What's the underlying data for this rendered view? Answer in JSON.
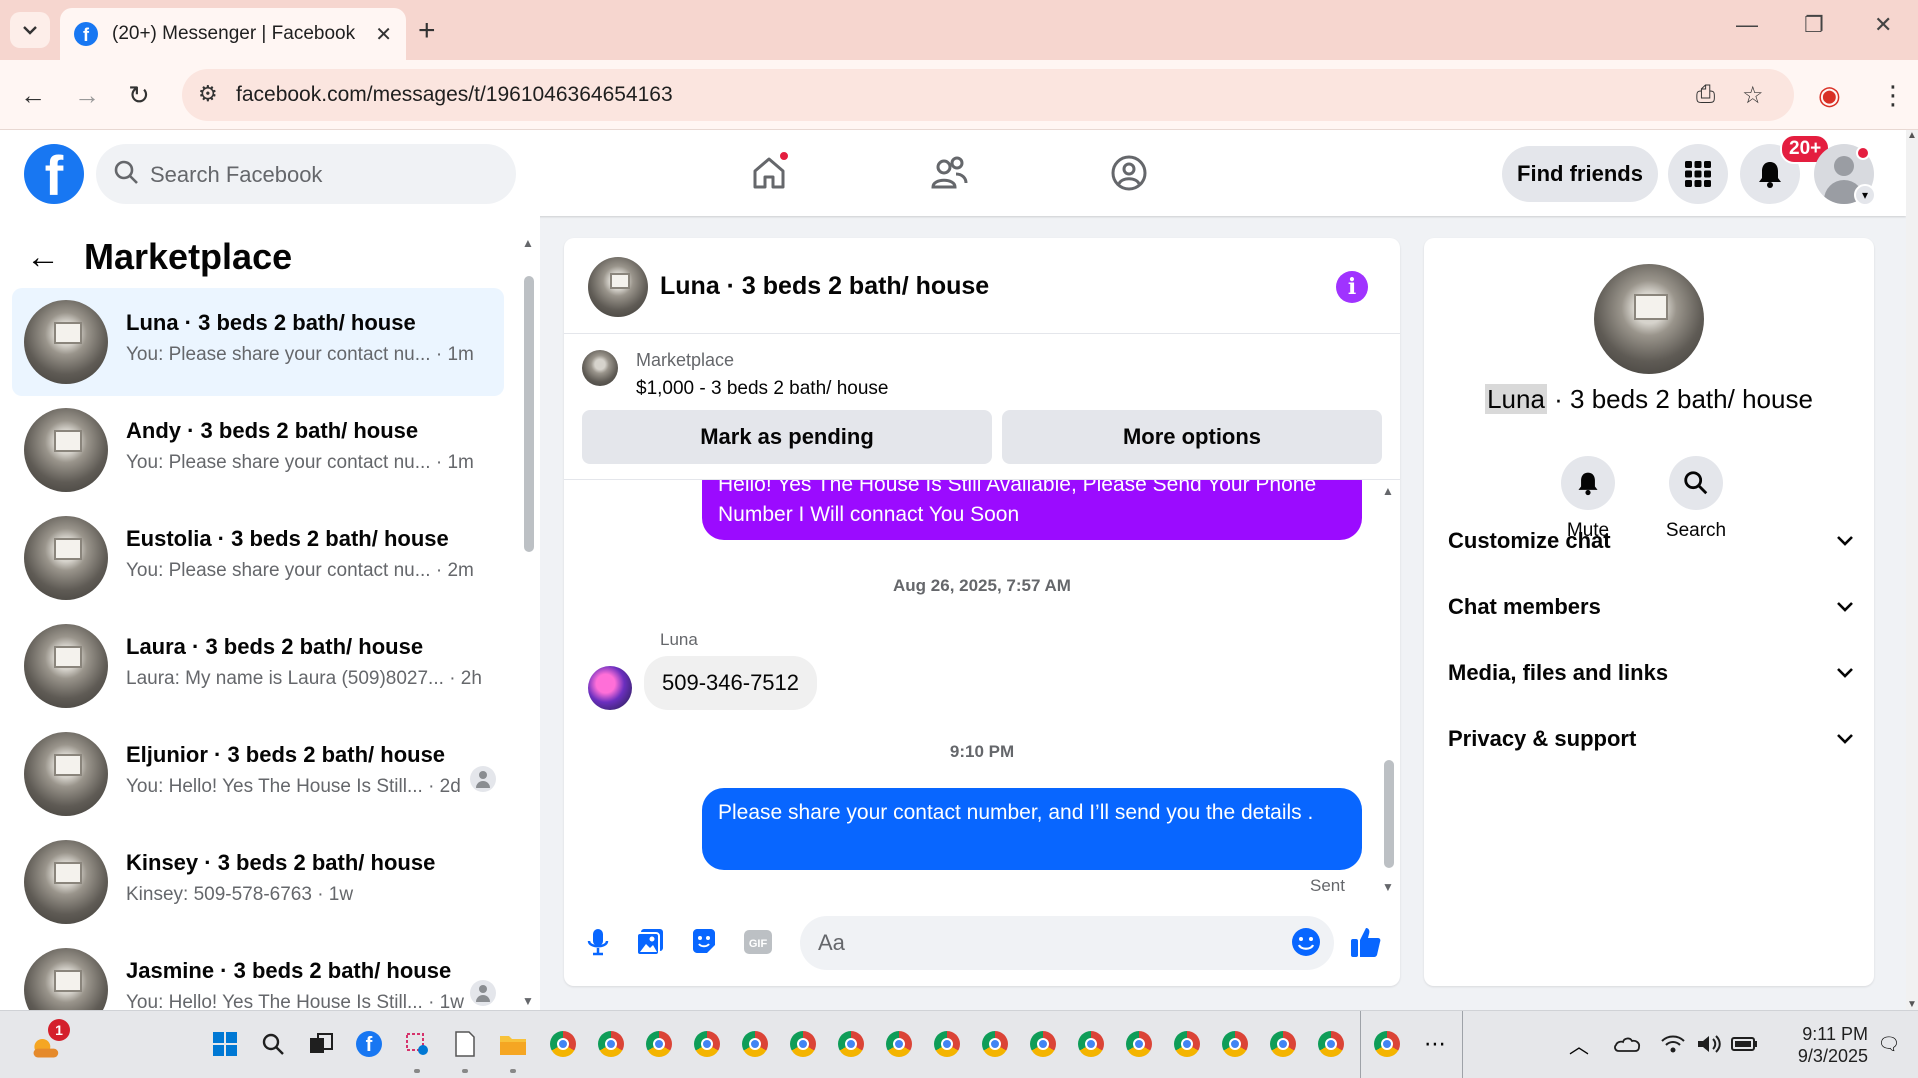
{
  "browser": {
    "tab_title": "(20+) Messenger | Facebook",
    "url": "facebook.com/messages/t/1961046364654163"
  },
  "fb_header": {
    "search_placeholder": "Search Facebook",
    "find_friends": "Find friends",
    "notification_badge": "20+"
  },
  "left_panel": {
    "title": "Marketplace",
    "conversations": [
      {
        "name": "Luna · 3 beds 2 bath/ house",
        "preview": "You: Please share your contact nu...",
        "time": "· 1m",
        "active": true
      },
      {
        "name": "Andy · 3 beds 2 bath/ house",
        "preview": "You: Please share your contact nu...",
        "time": "· 1m"
      },
      {
        "name": "Eustolia · 3 beds 2 bath/ house",
        "preview": "You: Please share your contact nu...",
        "time": "· 2m"
      },
      {
        "name": "Laura · 3 beds 2 bath/ house",
        "preview": "Laura: My name is Laura (509)8027...",
        "time": "· 2h"
      },
      {
        "name": "Eljunior · 3 beds 2 bath/ house",
        "preview": "You: Hello! Yes The House Is Still...",
        "time": "· 2d"
      },
      {
        "name": "Kinsey · 3 beds 2 bath/ house",
        "preview": "Kinsey: 509-578-6763",
        "time": "· 1w"
      },
      {
        "name": "Jasmine · 3 beds 2 bath/ house",
        "preview": "You: Hello! Yes The House Is Still...",
        "time": "· 1w"
      }
    ]
  },
  "chat": {
    "title": "Luna · 3 beds 2 bath/ house",
    "marketplace_label": "Marketplace",
    "listing": "$1,000 - 3 beds 2 bath/ house",
    "mark_pending": "Mark as pending",
    "more_options": "More options",
    "msg_out_1": "Hello! Yes The House  Is Still Available, Please Send Your Phone Number I Will connact You Soon",
    "timestamp_1": "Aug 26, 2025, 7:57 AM",
    "sender": "Luna",
    "msg_in_1": "509-346-7512",
    "timestamp_2": "9:10 PM",
    "msg_out_2": "Please share your contact number, and I’ll send you the details .",
    "status": "Sent",
    "composer_placeholder": "Aa"
  },
  "right_panel": {
    "name_first": "Luna",
    "name_rest": " · 3 beds 2 bath/ house",
    "mute": "Mute",
    "search": "Search",
    "sections": [
      "Customize chat",
      "Chat members",
      "Media, files and links",
      "Privacy & support"
    ]
  },
  "taskbar": {
    "time": "9:11 PM",
    "date": "9/3/2025",
    "weather_badge": "1"
  },
  "colors": {
    "fb_blue": "#1877f2",
    "outgoing_blue": "#0866ff",
    "outgoing_purple": "#9b0bff",
    "info_purple": "#a033ff",
    "notif_red": "#e41e3f"
  }
}
